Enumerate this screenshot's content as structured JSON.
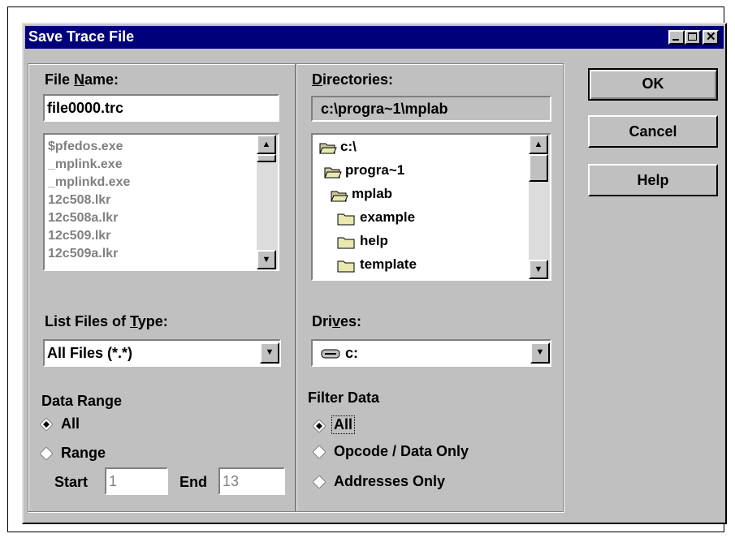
{
  "window": {
    "title": "Save Trace File",
    "controls": [
      "minimize",
      "maximize",
      "close"
    ]
  },
  "file_name": {
    "label_pre": "File ",
    "label_accel": "N",
    "label_post": "ame:",
    "value": "file0000.trc",
    "files": [
      "$pfedos.exe",
      "_mplink.exe",
      "_mplinkd.exe",
      "12c508.lkr",
      "12c508a.lkr",
      "12c509.lkr",
      "12c509a.lkr"
    ]
  },
  "directories": {
    "label_accel": "D",
    "label_post": "irectories:",
    "current": "c:\\progra~1\\mplab",
    "tree": [
      "c:\\",
      "progra~1",
      "mplab",
      "example",
      "help",
      "template"
    ]
  },
  "file_type": {
    "label_pre": "List Files of ",
    "label_accel": "T",
    "label_post": "ype:",
    "selected": "All Files (*.*)"
  },
  "drives": {
    "label_pre": "Dri",
    "label_accel": "v",
    "label_post": "es:",
    "selected": "c:"
  },
  "data_range": {
    "label": "Data Range",
    "options": [
      "All",
      "Range"
    ],
    "selected": "All",
    "start_label": "Start",
    "start_value": "1",
    "end_label": "End",
    "end_value": "13"
  },
  "filter_data": {
    "label": "Filter Data",
    "options": [
      "All",
      "Opcode / Data Only",
      "Addresses Only"
    ],
    "selected": "All"
  },
  "buttons": {
    "ok": "OK",
    "cancel": "Cancel",
    "help": "Help"
  }
}
